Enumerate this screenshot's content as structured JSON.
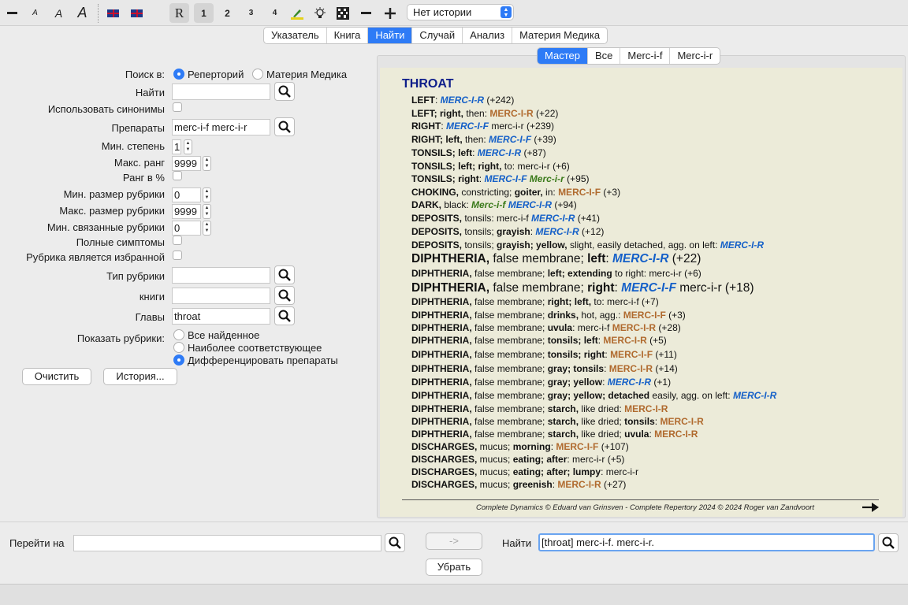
{
  "toolbar": {
    "buttons": [
      {
        "name": "minus-font-icon",
        "glyph": "▬"
      },
      {
        "name": "font-small-icon",
        "glyph": "A"
      },
      {
        "name": "font-medium-icon",
        "glyph": "A"
      },
      {
        "name": "font-large-icon",
        "glyph": "A"
      },
      {
        "name": "flag-uk-icon",
        "glyph": ""
      },
      {
        "name": "flag-uk-2-icon",
        "glyph": ""
      },
      {
        "name": "repertory-icon",
        "glyph": "R"
      },
      {
        "name": "grade-1-button",
        "glyph": "1"
      },
      {
        "name": "grade-2-button",
        "glyph": "2"
      },
      {
        "name": "grade-3-button",
        "glyph": "3"
      },
      {
        "name": "grade-4-button",
        "glyph": "4"
      },
      {
        "name": "highlighter-icon",
        "glyph": "✎"
      },
      {
        "name": "lightbulb-icon",
        "glyph": "💡"
      },
      {
        "name": "grid-icon",
        "glyph": "▦"
      },
      {
        "name": "zoom-out-icon",
        "glyph": "−"
      },
      {
        "name": "zoom-in-icon",
        "glyph": "+"
      }
    ],
    "history_select": "Нет истории"
  },
  "main_tabs": [
    {
      "label": "Указатель",
      "active": false
    },
    {
      "label": "Книга",
      "active": false
    },
    {
      "label": "Найти",
      "active": true
    },
    {
      "label": "Случай",
      "active": false
    },
    {
      "label": "Анализ",
      "active": false
    },
    {
      "label": "Материя Медика",
      "active": false
    }
  ],
  "form": {
    "search_in_label": "Поиск в:",
    "search_in_options": [
      "Реперторий",
      "Материя Медика"
    ],
    "find_label": "Найти",
    "find_value": "",
    "synonyms_label": "Использовать синонимы",
    "remedies_label": "Препараты",
    "remedies_value": "merc-i-f merc-i-r",
    "min_grade_label": "Мин. степень",
    "min_grade_value": "1",
    "max_rank_label": "Макс. ранг",
    "max_rank_value": "9999",
    "rank_percent_label": "Ранг в %",
    "min_rubric_size_label": "Мин. размер рубрики",
    "min_rubric_size_value": "0",
    "max_rubric_size_label": "Макс. размер рубрики",
    "max_rubric_size_value": "9999",
    "min_related_label": "Мин. связанные рубрики",
    "min_related_value": "0",
    "full_symptoms_label": "Полные симптомы",
    "favorite_label": "Рубрика является избранной",
    "rubric_type_label": "Тип рубрики",
    "rubric_type_value": "",
    "books_label": "книги",
    "books_value": "",
    "chapters_label": "Главы",
    "chapters_value": "throat",
    "show_rubrics_label": "Показать рубрики:",
    "show_options": [
      "Все найденное",
      "Наиболее соответствующее",
      "Дифференцировать препараты"
    ],
    "clear_button": "Очистить",
    "history_button": "История..."
  },
  "result_tabs": [
    {
      "label": "Мастер",
      "active": true
    },
    {
      "label": "Все",
      "active": false
    },
    {
      "label": "Merc-i-f",
      "active": false
    },
    {
      "label": "Merc-i-r",
      "active": false
    }
  ],
  "results": {
    "chapter": "THROAT",
    "footer": "Complete Dynamics © Eduard van Grinsven   -   Complete Repertory 2024 © 2024 Roger van Zandvoort",
    "rubrics": [
      {
        "big": false,
        "parts": [
          [
            "b",
            "LEFT"
          ],
          [
            "t",
            ": "
          ],
          [
            "rf",
            "MERC-I-R"
          ],
          [
            "t",
            " (+242)"
          ]
        ]
      },
      {
        "big": false,
        "parts": [
          [
            "b",
            "LEFT; right,"
          ],
          [
            "t",
            " then: "
          ],
          [
            "rr",
            "MERC-I-R"
          ],
          [
            "t",
            " (+22)"
          ]
        ]
      },
      {
        "big": false,
        "parts": [
          [
            "b",
            "RIGHT"
          ],
          [
            "t",
            ": "
          ],
          [
            "rf",
            "MERC-I-F"
          ],
          [
            "t",
            " merc-i-r (+239)"
          ]
        ]
      },
      {
        "big": false,
        "parts": [
          [
            "b",
            "RIGHT; left,"
          ],
          [
            "t",
            " then: "
          ],
          [
            "rf",
            "MERC-I-F"
          ],
          [
            "t",
            " (+39)"
          ]
        ]
      },
      {
        "big": false,
        "parts": [
          [
            "b",
            "TONSILS; left"
          ],
          [
            "t",
            ": "
          ],
          [
            "rf",
            "MERC-I-R"
          ],
          [
            "t",
            " (+87)"
          ]
        ]
      },
      {
        "big": false,
        "parts": [
          [
            "b",
            "TONSILS; left; right,"
          ],
          [
            "t",
            " to: merc-i-r (+6)"
          ]
        ]
      },
      {
        "big": false,
        "parts": [
          [
            "b",
            "TONSILS; right"
          ],
          [
            "t",
            ": "
          ],
          [
            "rf",
            "MERC-I-F"
          ],
          [
            "t",
            " "
          ],
          [
            "rg",
            "Merc-i-r"
          ],
          [
            "t",
            " (+95)"
          ]
        ]
      },
      {
        "big": false,
        "parts": [
          [
            "b",
            "CHOKING,"
          ],
          [
            "t",
            " constricting; "
          ],
          [
            "b",
            "goiter,"
          ],
          [
            "t",
            " in: "
          ],
          [
            "rr",
            "MERC-I-F"
          ],
          [
            "t",
            " (+3)"
          ]
        ]
      },
      {
        "big": false,
        "parts": [
          [
            "b",
            "DARK,"
          ],
          [
            "t",
            " black: "
          ],
          [
            "rg",
            "Merc-i-f"
          ],
          [
            "t",
            " "
          ],
          [
            "rf",
            "MERC-I-R"
          ],
          [
            "t",
            " (+94)"
          ]
        ]
      },
      {
        "big": false,
        "parts": [
          [
            "b",
            "DEPOSITS,"
          ],
          [
            "t",
            " tonsils: merc-i-f "
          ],
          [
            "rf",
            "MERC-I-R"
          ],
          [
            "t",
            " (+41)"
          ]
        ]
      },
      {
        "big": false,
        "parts": [
          [
            "b",
            "DEPOSITS,"
          ],
          [
            "t",
            " tonsils; "
          ],
          [
            "b",
            "grayish"
          ],
          [
            "t",
            ": "
          ],
          [
            "rf",
            "MERC-I-R"
          ],
          [
            "t",
            " (+12)"
          ]
        ]
      },
      {
        "big": false,
        "parts": [
          [
            "b",
            "DEPOSITS,"
          ],
          [
            "t",
            " tonsils; "
          ],
          [
            "b",
            "grayish; yellow,"
          ],
          [
            "t",
            " slight, easily detached, agg. on left: "
          ],
          [
            "rf",
            "MERC-I-R"
          ]
        ]
      },
      {
        "big": true,
        "parts": [
          [
            "b",
            "DIPHTHERIA,"
          ],
          [
            "t",
            " false membrane; "
          ],
          [
            "b",
            "left"
          ],
          [
            "t",
            ": "
          ],
          [
            "rf",
            "MERC-I-R"
          ],
          [
            "t",
            " (+22)"
          ]
        ]
      },
      {
        "big": false,
        "parts": [
          [
            "b",
            "DIPHTHERIA,"
          ],
          [
            "t",
            " false membrane; "
          ],
          [
            "b",
            "left; extending"
          ],
          [
            "t",
            " to right: merc-i-r (+6)"
          ]
        ]
      },
      {
        "big": true,
        "parts": [
          [
            "b",
            "DIPHTHERIA,"
          ],
          [
            "t",
            " false membrane; "
          ],
          [
            "b",
            "right"
          ],
          [
            "t",
            ": "
          ],
          [
            "rf",
            "MERC-I-F"
          ],
          [
            "t",
            " merc-i-r (+18)"
          ]
        ]
      },
      {
        "big": false,
        "parts": [
          [
            "b",
            "DIPHTHERIA,"
          ],
          [
            "t",
            " false membrane; "
          ],
          [
            "b",
            "right; left,"
          ],
          [
            "t",
            " to: merc-i-f (+7)"
          ]
        ]
      },
      {
        "big": false,
        "parts": [
          [
            "b",
            "DIPHTHERIA,"
          ],
          [
            "t",
            " false membrane; "
          ],
          [
            "b",
            "drinks,"
          ],
          [
            "t",
            " hot, agg.: "
          ],
          [
            "rr",
            "MERC-I-F"
          ],
          [
            "t",
            " (+3)"
          ]
        ]
      },
      {
        "big": false,
        "parts": [
          [
            "b",
            "DIPHTHERIA,"
          ],
          [
            "t",
            " false membrane; "
          ],
          [
            "b",
            "uvula"
          ],
          [
            "t",
            ": merc-i-f "
          ],
          [
            "rr",
            "MERC-I-R"
          ],
          [
            "t",
            " (+28)"
          ]
        ]
      },
      {
        "big": false,
        "parts": [
          [
            "b",
            "DIPHTHERIA,"
          ],
          [
            "t",
            " false membrane; "
          ],
          [
            "b",
            "tonsils; left"
          ],
          [
            "t",
            ": "
          ],
          [
            "rr",
            "MERC-I-R"
          ],
          [
            "t",
            " (+5)"
          ]
        ]
      },
      {
        "big": false,
        "parts": [
          [
            "b",
            "DIPHTHERIA,"
          ],
          [
            "t",
            " false membrane; "
          ],
          [
            "b",
            "tonsils; right"
          ],
          [
            "t",
            ": "
          ],
          [
            "rr",
            "MERC-I-F"
          ],
          [
            "t",
            " (+11)"
          ]
        ]
      },
      {
        "big": false,
        "parts": [
          [
            "b",
            "DIPHTHERIA,"
          ],
          [
            "t",
            " false membrane; "
          ],
          [
            "b",
            "gray; tonsils"
          ],
          [
            "t",
            ": "
          ],
          [
            "rr",
            "MERC-I-R"
          ],
          [
            "t",
            " (+14)"
          ]
        ]
      },
      {
        "big": false,
        "parts": [
          [
            "b",
            "DIPHTHERIA,"
          ],
          [
            "t",
            " false membrane; "
          ],
          [
            "b",
            "gray; yellow"
          ],
          [
            "t",
            ": "
          ],
          [
            "rf",
            "MERC-I-R"
          ],
          [
            "t",
            " (+1)"
          ]
        ]
      },
      {
        "big": false,
        "parts": [
          [
            "b",
            "DIPHTHERIA,"
          ],
          [
            "t",
            " false membrane; "
          ],
          [
            "b",
            "gray; yellow; detached"
          ],
          [
            "t",
            " easily, agg. on left: "
          ],
          [
            "rf",
            "MERC-I-R"
          ]
        ]
      },
      {
        "big": false,
        "parts": [
          [
            "b",
            "DIPHTHERIA,"
          ],
          [
            "t",
            " false membrane; "
          ],
          [
            "b",
            "starch,"
          ],
          [
            "t",
            " like dried: "
          ],
          [
            "rr",
            "MERC-I-R"
          ]
        ]
      },
      {
        "big": false,
        "parts": [
          [
            "b",
            "DIPHTHERIA,"
          ],
          [
            "t",
            " false membrane; "
          ],
          [
            "b",
            "starch,"
          ],
          [
            "t",
            " like dried; "
          ],
          [
            "b",
            "tonsils"
          ],
          [
            "t",
            ": "
          ],
          [
            "rr",
            "MERC-I-R"
          ]
        ]
      },
      {
        "big": false,
        "parts": [
          [
            "b",
            "DIPHTHERIA,"
          ],
          [
            "t",
            " false membrane; "
          ],
          [
            "b",
            "starch,"
          ],
          [
            "t",
            " like dried; "
          ],
          [
            "b",
            "uvula"
          ],
          [
            "t",
            ": "
          ],
          [
            "rr",
            "MERC-I-R"
          ]
        ]
      },
      {
        "big": false,
        "parts": [
          [
            "b",
            "DISCHARGES,"
          ],
          [
            "t",
            " mucus; "
          ],
          [
            "b",
            "morning"
          ],
          [
            "t",
            ": "
          ],
          [
            "rr",
            "MERC-I-F"
          ],
          [
            "t",
            " (+107)"
          ]
        ]
      },
      {
        "big": false,
        "parts": [
          [
            "b",
            "DISCHARGES,"
          ],
          [
            "t",
            " mucus; "
          ],
          [
            "b",
            "eating; after"
          ],
          [
            "t",
            ": merc-i-r (+5)"
          ]
        ]
      },
      {
        "big": false,
        "parts": [
          [
            "b",
            "DISCHARGES,"
          ],
          [
            "t",
            " mucus; "
          ],
          [
            "b",
            "eating; after; lumpy"
          ],
          [
            "t",
            ": merc-i-r"
          ]
        ]
      },
      {
        "big": false,
        "parts": [
          [
            "b",
            "DISCHARGES,"
          ],
          [
            "t",
            " mucus; "
          ],
          [
            "b",
            "greenish"
          ],
          [
            "t",
            ": "
          ],
          [
            "rr",
            "MERC-I-R"
          ],
          [
            "t",
            " (+27)"
          ]
        ]
      }
    ]
  },
  "bottom": {
    "goto_label": "Перейти на",
    "goto_value": "",
    "arrow_button": "->",
    "find_label": "Найти",
    "find_value": "[throat] merc-i-f. merc-i-r.",
    "remove_button": "Убрать"
  }
}
